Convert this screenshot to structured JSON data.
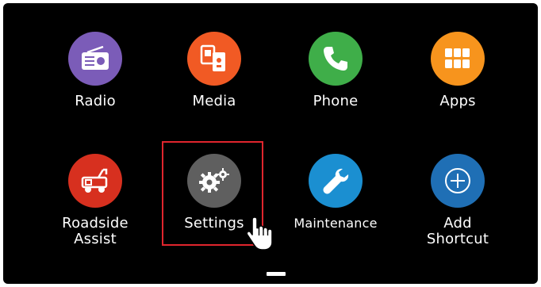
{
  "apps": [
    {
      "id": "radio",
      "label": "Radio",
      "icon": "radio-icon",
      "color": "#7b5cb8"
    },
    {
      "id": "media",
      "label": "Media",
      "icon": "media-icon",
      "color": "#f15a24"
    },
    {
      "id": "phone",
      "label": "Phone",
      "icon": "phone-icon",
      "color": "#3fae49"
    },
    {
      "id": "apps",
      "label": "Apps",
      "icon": "apps-grid-icon",
      "color": "#f7941d"
    },
    {
      "id": "roadside",
      "label_line1": "Roadside",
      "label_line2": "Assist",
      "icon": "tow-truck-icon",
      "color": "#d7301f"
    },
    {
      "id": "settings",
      "label": "Settings",
      "icon": "gears-icon",
      "color": "#5f5f5f",
      "highlighted": true
    },
    {
      "id": "maintenance",
      "label": "Maintenance",
      "icon": "wrench-icon",
      "color": "#1b8fd1"
    },
    {
      "id": "add-shortcut",
      "label_line1": "Add",
      "label_line2": "Shortcut",
      "icon": "plus-circle-icon",
      "color": "#1f6fb5"
    }
  ],
  "highlight_color": "#e0252d",
  "cursor": "hand-pointer-icon"
}
